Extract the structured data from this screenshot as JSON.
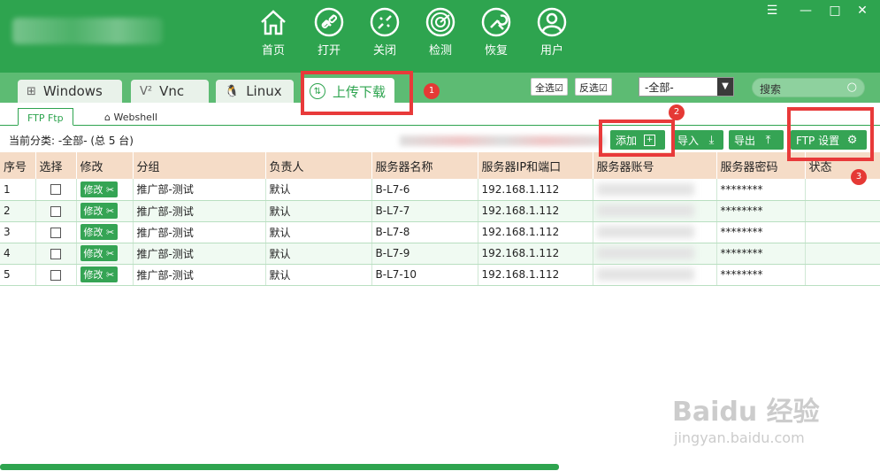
{
  "toolbar": {
    "items": [
      {
        "label": "首页",
        "icon": "home-icon"
      },
      {
        "label": "打开",
        "icon": "link-icon"
      },
      {
        "label": "关闭",
        "icon": "unlink-icon"
      },
      {
        "label": "检测",
        "icon": "radar-icon"
      },
      {
        "label": "恢复",
        "icon": "wrench-icon"
      },
      {
        "label": "用户",
        "icon": "user-icon"
      }
    ]
  },
  "window_controls": {
    "menu": "☰",
    "minimize": "—",
    "maximize": "□",
    "close": "✕"
  },
  "tabs": [
    {
      "label": "Windows",
      "glyph": "⊞"
    },
    {
      "label": "Vnc",
      "glyph": "V²"
    },
    {
      "label": "Linux",
      "glyph": "🐧"
    },
    {
      "label": "上传下载",
      "glyph": "⇅"
    }
  ],
  "filter": {
    "select_all": "全选☑",
    "invert_select": "反选☑",
    "group_select": "-全部-",
    "search_placeholder": "搜索"
  },
  "subtabs": [
    {
      "label": "FTP   Ftp"
    },
    {
      "label": "Webshell"
    }
  ],
  "category": {
    "label": "当前分类:",
    "value": "-全部- (总 5 台)"
  },
  "actions": {
    "add": "添加",
    "import": "导入",
    "export": "导出",
    "ftp_settings": "FTP  设置"
  },
  "table": {
    "headers": [
      "序号",
      "选择",
      "修改",
      "分组",
      "负责人",
      "服务器名称",
      "服务器IP和端口",
      "服务器账号",
      "服务器密码",
      "状态"
    ],
    "edit_label": "修改",
    "rows": [
      {
        "no": "1",
        "group": "推广部-测试",
        "owner": "默认",
        "name": "B-L7-6",
        "ip": "192.168.1.112",
        "password": "********"
      },
      {
        "no": "2",
        "group": "推广部-测试",
        "owner": "默认",
        "name": "B-L7-7",
        "ip": "192.168.1.112",
        "password": "********"
      },
      {
        "no": "3",
        "group": "推广部-测试",
        "owner": "默认",
        "name": "B-L7-8",
        "ip": "192.168.1.112",
        "password": "********"
      },
      {
        "no": "4",
        "group": "推广部-测试",
        "owner": "默认",
        "name": "B-L7-9",
        "ip": "192.168.1.112",
        "password": "********"
      },
      {
        "no": "5",
        "group": "推广部-测试",
        "owner": "默认",
        "name": "B-L7-10",
        "ip": "192.168.1.112",
        "password": "********"
      }
    ]
  },
  "annotations": [
    "1",
    "2",
    "3"
  ],
  "watermark": {
    "main": "Baidu 经验",
    "sub": "jingyan.baidu.com"
  }
}
